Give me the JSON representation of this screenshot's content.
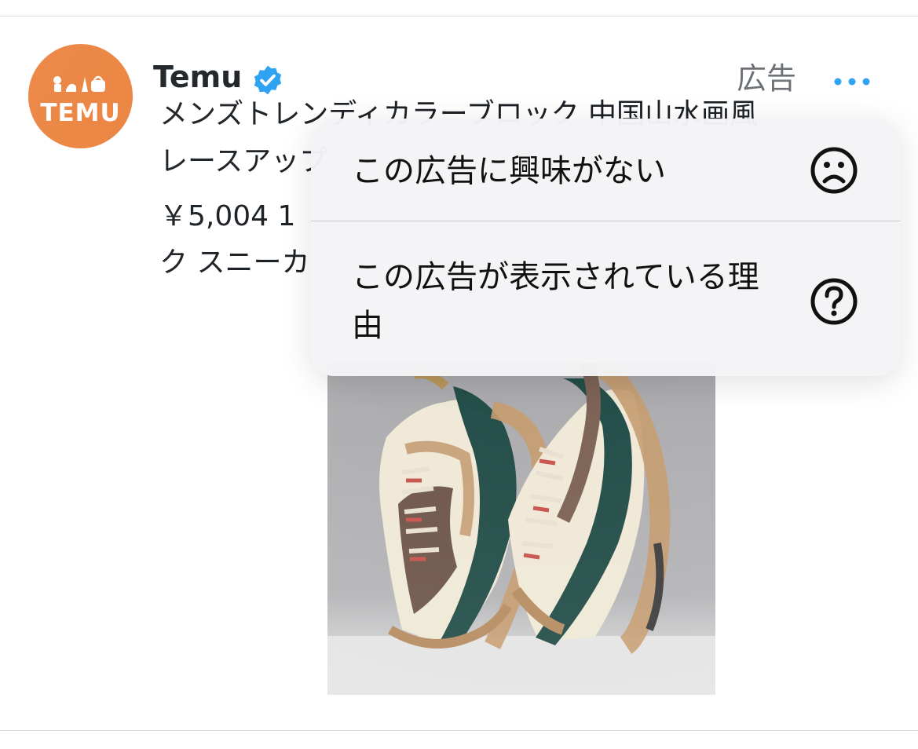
{
  "post": {
    "author": "Temu",
    "avatar_text": "TEMU",
    "ad_label": "広告",
    "text_lines": [
      "メンズトレンディカラーブロック 中国山水画風",
      "レースアップ",
      "￥5,004 1",
      "ク スニーカ"
    ],
    "media_alt": "sneakers-photo"
  },
  "menu": {
    "items": [
      {
        "label": "この広告に興味がない",
        "icon": "frown-face-icon"
      },
      {
        "label": "この広告が表示されている理由",
        "icon": "question-circle-icon"
      }
    ]
  },
  "colors": {
    "brand_orange": "#ea7a31",
    "verified_blue": "#1d9bf0",
    "text_primary": "#0f1419",
    "text_secondary": "#62676c"
  }
}
